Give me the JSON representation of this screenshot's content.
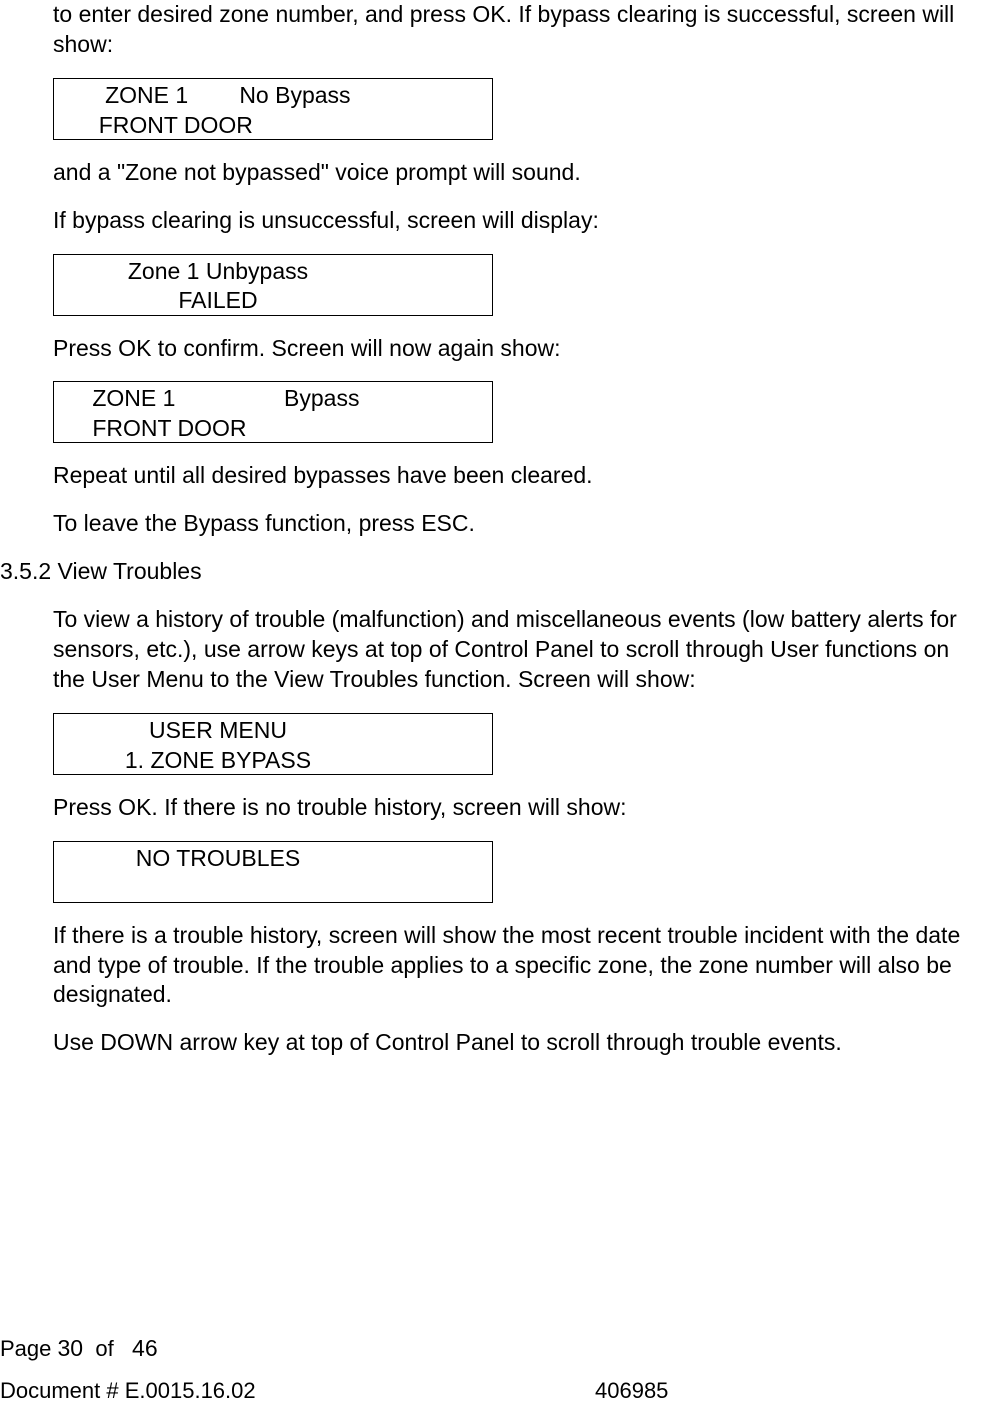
{
  "para1": "to enter desired zone number, and press OK. If bypass clearing is successful, screen will show:",
  "display1": {
    "line1": "        ZONE 1        No Bypass",
    "line2": "       FRONT DOOR"
  },
  "para2": "and a \"Zone not bypassed\" voice prompt will sound.",
  "para3": "If bypass clearing is unsuccessful, screen will display:",
  "display2": {
    "line1": "Zone 1 Unbypass",
    "line2": "FAILED"
  },
  "para4": "Press OK to confirm. Screen will now again show:",
  "display3": {
    "line1": "      ZONE 1                 Bypass",
    "line2": "      FRONT DOOR"
  },
  "para5": "Repeat until all desired bypasses have been cleared.",
  "para6": "To leave the Bypass function, press ESC.",
  "section_number": "3.5.2",
  "section_title": "View Troubles",
  "para7": "To view a history of trouble (malfunction) and miscellaneous events (low battery alerts for sensors, etc.), use arrow keys at top of Control Panel to scroll through User functions on the User Menu to the View Troubles function. Screen will show:",
  "display4": {
    "line1": "USER MENU",
    "line2": "1. ZONE BYPASS"
  },
  "para8": "Press OK. If there is no trouble history, screen will show:",
  "display5": {
    "line1": "NO TROUBLES",
    "line2": " "
  },
  "para9": "If there is a trouble history, screen will show the most recent trouble incident with the date and type of trouble. If the trouble applies to a specific zone, the zone number will also be designated.",
  "para10": "Use DOWN arrow key at top of Control Panel to scroll through trouble events.",
  "footer": {
    "page_label": "Page",
    "page_current": "30",
    "page_of": "of",
    "page_total": "46",
    "doc_label": "Document # E.0015.16.02",
    "doc_number": "406985"
  }
}
